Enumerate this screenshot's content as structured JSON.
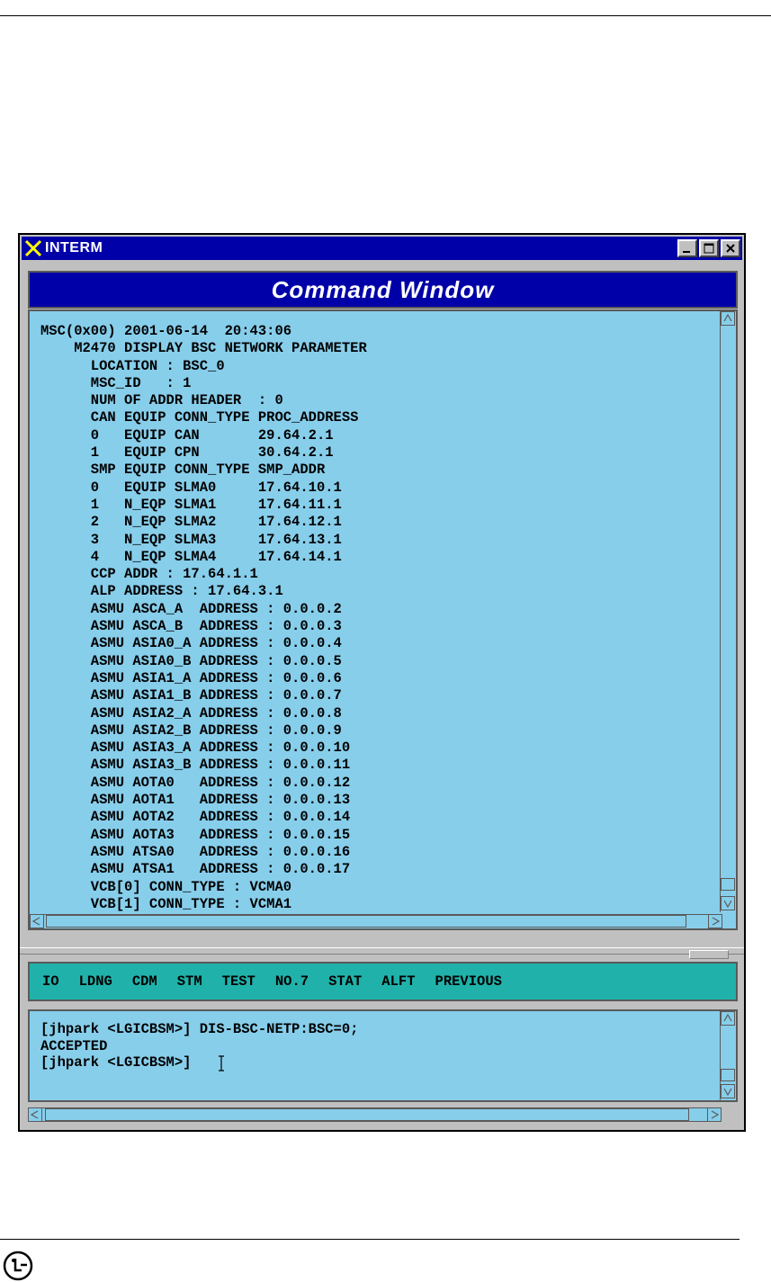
{
  "window": {
    "title": "INTERM",
    "header_title": "Command Window"
  },
  "output": {
    "lines": [
      "MSC(0x00) 2001-06-14  20:43:06",
      "    M2470 DISPLAY BSC NETWORK PARAMETER",
      "      LOCATION : BSC_0",
      "      MSC_ID   : 1",
      "      NUM OF ADDR HEADER  : 0",
      "      CAN EQUIP CONN_TYPE PROC_ADDRESS",
      "      0   EQUIP CAN       29.64.2.1",
      "      1   EQUIP CPN       30.64.2.1",
      "      SMP EQUIP CONN_TYPE SMP_ADDR",
      "      0   EQUIP SLMA0     17.64.10.1",
      "      1   N_EQP SLMA1     17.64.11.1",
      "      2   N_EQP SLMA2     17.64.12.1",
      "      3   N_EQP SLMA3     17.64.13.1",
      "      4   N_EQP SLMA4     17.64.14.1",
      "      CCP ADDR : 17.64.1.1",
      "      ALP ADDRESS : 17.64.3.1",
      "      ASMU ASCA_A  ADDRESS : 0.0.0.2",
      "      ASMU ASCA_B  ADDRESS : 0.0.0.3",
      "      ASMU ASIA0_A ADDRESS : 0.0.0.4",
      "      ASMU ASIA0_B ADDRESS : 0.0.0.5",
      "      ASMU ASIA1_A ADDRESS : 0.0.0.6",
      "      ASMU ASIA1_B ADDRESS : 0.0.0.7",
      "      ASMU ASIA2_A ADDRESS : 0.0.0.8",
      "      ASMU ASIA2_B ADDRESS : 0.0.0.9",
      "      ASMU ASIA3_A ADDRESS : 0.0.0.10",
      "      ASMU ASIA3_B ADDRESS : 0.0.0.11",
      "      ASMU AOTA0   ADDRESS : 0.0.0.12",
      "      ASMU AOTA1   ADDRESS : 0.0.0.13",
      "      ASMU AOTA2   ADDRESS : 0.0.0.14",
      "      ASMU AOTA3   ADDRESS : 0.0.0.15",
      "      ASMU ATSA0   ADDRESS : 0.0.0.16",
      "      ASMU ATSA1   ADDRESS : 0.0.0.17",
      "      VCB[0] CONN_TYPE : VCMA0",
      "      VCB[1] CONN_TYPE : VCMA1"
    ]
  },
  "menu": [
    {
      "label": "IO",
      "name": "menu-io"
    },
    {
      "label": "LDNG",
      "name": "menu-ldng"
    },
    {
      "label": "CDM",
      "name": "menu-cdm"
    },
    {
      "label": "STM",
      "name": "menu-stm"
    },
    {
      "label": "TEST",
      "name": "menu-test"
    },
    {
      "label": "NO.7",
      "name": "menu-no7"
    },
    {
      "label": "STAT",
      "name": "menu-stat"
    },
    {
      "label": "ALFT",
      "name": "menu-alft"
    },
    {
      "label": "PREVIOUS",
      "name": "menu-previous"
    }
  ],
  "input": {
    "lines": [
      "[jhpark <LGICBSM>] DIS-BSC-NETP:BSC=0;",
      "ACCEPTED",
      "[jhpark <LGICBSM>]"
    ]
  },
  "colors": {
    "title_bar": "#0000a8",
    "pane_background": "#87ceeb",
    "menu_background": "#20b2aa"
  }
}
